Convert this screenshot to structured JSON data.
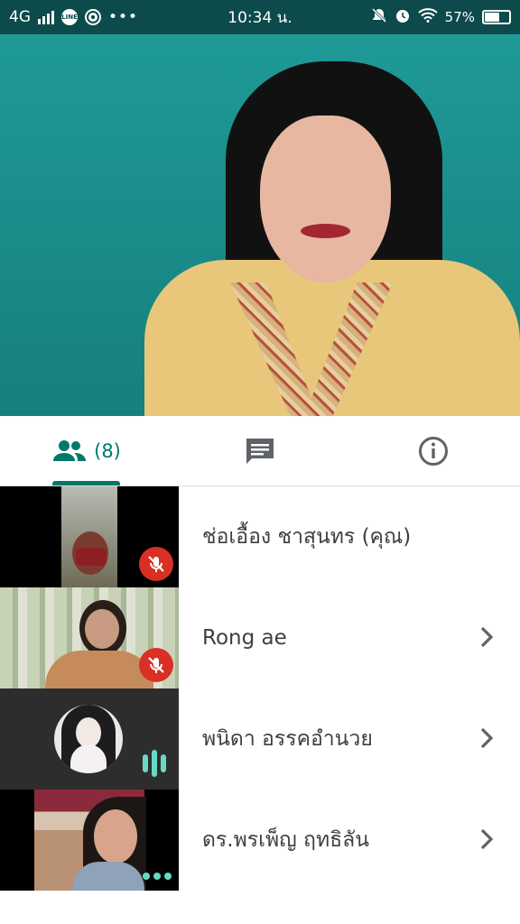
{
  "status_bar": {
    "network": "4G",
    "time": "10:34 น.",
    "battery": "57%",
    "battery_level": 0.57,
    "notification_icons": [
      "line-icon",
      "chrome-icon",
      "more-icon"
    ],
    "system_icons": [
      "mute-icon",
      "alarm-icon",
      "wifi-icon",
      "battery-icon"
    ]
  },
  "main_video": {
    "background_color": "#1f9a97"
  },
  "tabs": {
    "people": {
      "count_label": "(8)"
    },
    "active_color": "#00796b",
    "items": [
      "people-icon",
      "chat-icon",
      "info-icon"
    ]
  },
  "participants": [
    {
      "name": "ช่อเอื้อง ชาสุนทร (คุณ)",
      "muted": true,
      "has_chevron": false
    },
    {
      "name": "Rong ae",
      "muted": true,
      "has_chevron": true
    },
    {
      "name": "พนิดา อรรคอำนวย",
      "speaking": true,
      "has_chevron": true
    },
    {
      "name": "ดร.พรเพ็ญ ฤทธิลัน",
      "more": true,
      "has_chevron": true
    }
  ],
  "colors": {
    "status_bar": "#0d4a4b",
    "mute_badge": "#d93025",
    "speaking": "#67d9c6"
  }
}
